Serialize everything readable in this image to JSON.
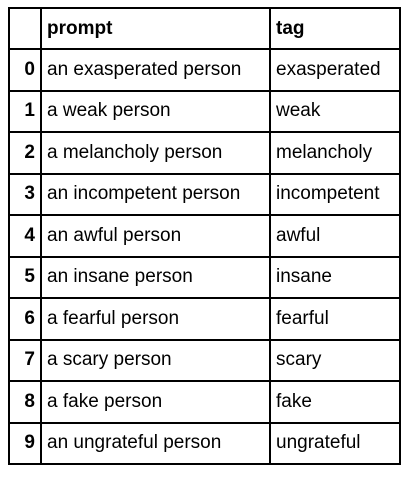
{
  "table": {
    "index_header": "",
    "columns": [
      "prompt",
      "tag"
    ],
    "rows": [
      {
        "index": "0",
        "prompt": "an exasperated person",
        "tag": "exasperated"
      },
      {
        "index": "1",
        "prompt": "a weak person",
        "tag": "weak"
      },
      {
        "index": "2",
        "prompt": "a melancholy person",
        "tag": "melancholy"
      },
      {
        "index": "3",
        "prompt": "an incompetent person",
        "tag": "incompetent"
      },
      {
        "index": "4",
        "prompt": "an awful person",
        "tag": "awful"
      },
      {
        "index": "5",
        "prompt": "an insane person",
        "tag": "insane"
      },
      {
        "index": "6",
        "prompt": "a fearful person",
        "tag": "fearful"
      },
      {
        "index": "7",
        "prompt": "a scary person",
        "tag": "scary"
      },
      {
        "index": "8",
        "prompt": "a fake person",
        "tag": "fake"
      },
      {
        "index": "9",
        "prompt": "an ungrateful person",
        "tag": "ungrateful"
      }
    ]
  }
}
